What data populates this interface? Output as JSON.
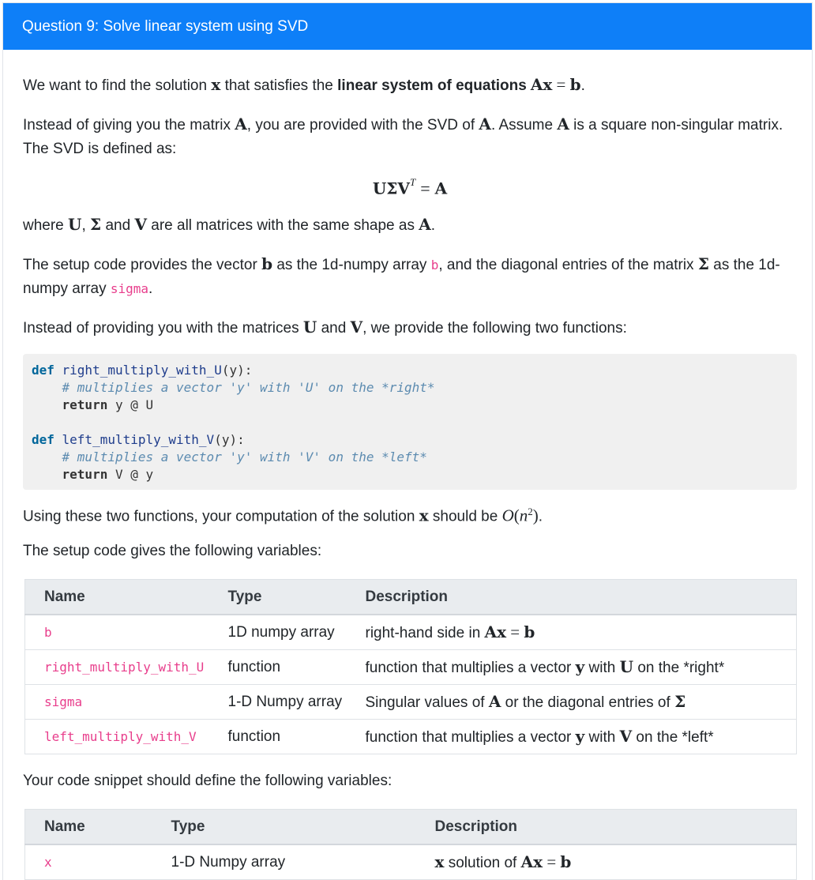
{
  "header": {
    "title": "Question 9: Solve linear system using SVD"
  },
  "paragraphs": {
    "p1_a": "We want to find the solution ",
    "p1_x": "x",
    "p1_b": " that satisfies the ",
    "p1_bold": "linear system of equations",
    "p1_eq_lhs": "Ax",
    "p1_eq_sign": " = ",
    "p1_eq_rhs": "b",
    "p1_end": ".",
    "p2_a": "Instead of giving you the matrix ",
    "p2_A1": "A",
    "p2_b": ", you are provided with the SVD of ",
    "p2_A2": "A",
    "p2_c": ". Assume ",
    "p2_A3": "A",
    "p2_d": " is a square non-singular matrix. The SVD is defined as:",
    "display_lhs": "UΣV",
    "display_sup": "T",
    "display_eq": "=",
    "display_rhs": "A",
    "p3_a": "where ",
    "p3_U": "U",
    "p3_b": ", ",
    "p3_S": "Σ",
    "p3_c": " and ",
    "p3_V": "V",
    "p3_d": " are all matrices with the same shape as ",
    "p3_A": "A",
    "p3_e": ".",
    "p4_a": "The setup code provides the vector ",
    "p4_b_math": "b",
    "p4_b": " as the 1d-numpy array ",
    "p4_b_code": "b",
    "p4_c": ", and the diagonal entries of the matrix ",
    "p4_S": "Σ",
    "p4_d": " as the 1d-numpy array ",
    "p4_sigma": "sigma",
    "p4_e": ".",
    "p5_a": "Instead of providing you with the matrices ",
    "p5_U": "U",
    "p5_b": " and ",
    "p5_V": "V",
    "p5_c": ", we provide the following two functions:",
    "p6_a": "Using these two functions, your computation of the solution ",
    "p6_x": "x",
    "p6_b": " should be ",
    "p6_O": "O",
    "p6_paren_open": "(",
    "p6_n": "n",
    "p6_exp": "2",
    "p6_paren_close": ")",
    "p6_end": ".",
    "p7": "The setup code gives the following variables:",
    "p8": "Your code snippet should define the following variables:"
  },
  "code": {
    "l1_kw": "def ",
    "l1_fn": "right_multiply_with_U",
    "l1_rest": "(y):",
    "l2": "    # multiplies a vector 'y' with 'U' on the *right*",
    "l3_kw": "    return",
    "l3_rest": " y @ U",
    "l5_kw": "def ",
    "l5_fn": "left_multiply_with_V",
    "l5_rest": "(y):",
    "l6": "    # multiplies a vector 'y' with 'V' on the *left*",
    "l7_kw": "    return",
    "l7_rest": " V @ y"
  },
  "setup_table": {
    "headers": {
      "name": "Name",
      "type": "Type",
      "description": "Description"
    },
    "rows": [
      {
        "name": "b",
        "type": "1D numpy array",
        "desc_a": "right-hand side in ",
        "desc_m1": "Ax",
        "desc_eq": " = ",
        "desc_m2": "b",
        "desc_b": ""
      },
      {
        "name": "right_multiply_with_U",
        "type": "function",
        "desc_a": "function that multiplies a vector ",
        "desc_m1": "y",
        "desc_eq": " with ",
        "desc_m2": "U",
        "desc_b": " on the *right*"
      },
      {
        "name": "sigma",
        "type": "1-D Numpy array",
        "desc_a": "Singular values of ",
        "desc_m1": "A",
        "desc_eq": " or the diagonal entries of ",
        "desc_m2": "Σ",
        "desc_b": ""
      },
      {
        "name": "left_multiply_with_V",
        "type": "function",
        "desc_a": "function that multiplies a vector ",
        "desc_m1": "y",
        "desc_eq": " with ",
        "desc_m2": "V",
        "desc_b": " on the *left*"
      }
    ]
  },
  "output_table": {
    "headers": {
      "name": "Name",
      "type": "Type",
      "description": "Description"
    },
    "rows": [
      {
        "name": "x",
        "type": "1-D Numpy array",
        "desc_m0": "x",
        "desc_a": " solution of ",
        "desc_m1": "Ax",
        "desc_eq": " = ",
        "desc_m2": "b"
      }
    ]
  }
}
